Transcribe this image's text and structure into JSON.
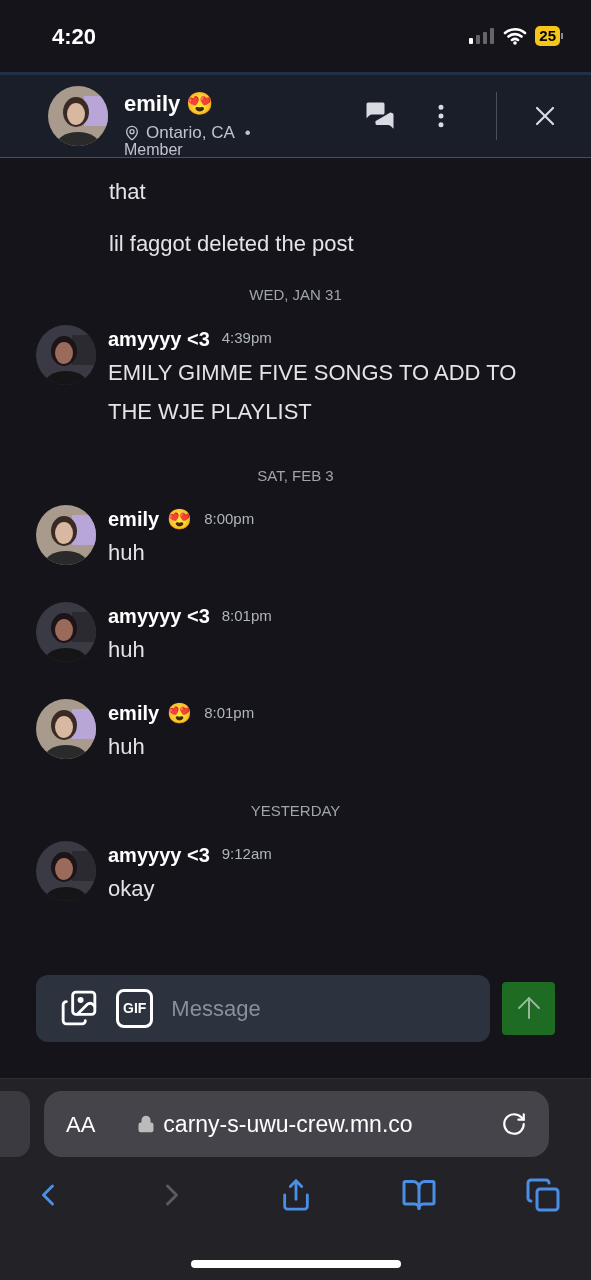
{
  "status_bar": {
    "time": "4:20",
    "battery": "25"
  },
  "header": {
    "name": "emily",
    "emoji": "😍",
    "location": "Ontario, CA",
    "separator": "•",
    "role": "Member"
  },
  "feed": [
    {
      "kind": "continuation",
      "text": "that"
    },
    {
      "kind": "continuation",
      "text": "lil faggot deleted the post"
    },
    {
      "kind": "date",
      "text": "WED, JAN 31"
    },
    {
      "kind": "message",
      "author": "amyyyy <3",
      "time": "4:39pm",
      "text": "EMILY GIMME FIVE SONGS TO ADD TO THE WJE PLAYLIST"
    },
    {
      "kind": "date",
      "text": "SAT, FEB 3"
    },
    {
      "kind": "message",
      "author": "emily",
      "emoji": "😍",
      "time": "8:00pm",
      "text": "huh"
    },
    {
      "kind": "message",
      "author": "amyyyy <3",
      "time": "8:01pm",
      "text": "huh"
    },
    {
      "kind": "message",
      "author": "emily",
      "emoji": "😍",
      "time": "8:01pm",
      "text": "huh"
    },
    {
      "kind": "date",
      "text": "YESTERDAY"
    },
    {
      "kind": "message",
      "author": "amyyyy <3",
      "time": "9:12am",
      "text": "okay"
    }
  ],
  "composer": {
    "gif": "GIF",
    "placeholder": "Message"
  },
  "browser": {
    "text_size": "AA",
    "url": "carny-s-uwu-crew.mn.co",
    "forward_disabled": true
  }
}
